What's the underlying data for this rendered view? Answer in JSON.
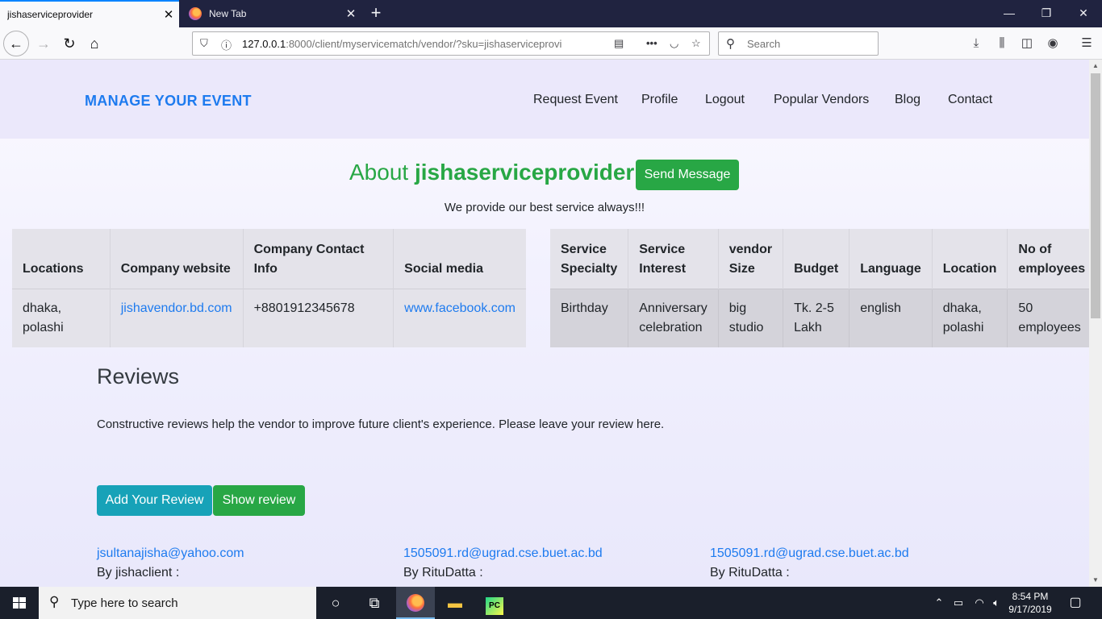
{
  "browser": {
    "tabs": [
      {
        "title": "jishaserviceprovider",
        "active": true
      },
      {
        "title": "New Tab",
        "active": false
      }
    ],
    "url_host": "127.0.0.1",
    "url_rest": ":8000/client/myservicematch/vendor/?sku=jishaserviceprovi",
    "search_placeholder": "Search"
  },
  "site": {
    "brand": "MANAGE YOUR EVENT",
    "nav": [
      "Request Event",
      "Profile",
      "Logout",
      "Popular Vendors",
      "Blog",
      "Contact"
    ]
  },
  "about": {
    "prefix": "About ",
    "vendor_name": "jishaserviceprovider",
    "send_message_label": "Send Message",
    "tagline": "We provide our best service always!!!"
  },
  "company_table": {
    "headers": [
      "Locations",
      "Company website",
      "Company Contact Info",
      "Social media"
    ],
    "row": [
      "dhaka, polashi",
      "jishavendor.bd.com",
      "+8801912345678",
      "www.facebook.com"
    ]
  },
  "service_table": {
    "headers": [
      "Service Specialty",
      "Service Interest",
      "vendor Size",
      "Budget",
      "Language",
      "Location",
      "No of employees"
    ],
    "row": [
      "Birthday",
      "Anniversary celebration",
      "big studio",
      "Tk. 2-5 Lakh",
      "english",
      "dhaka, polashi",
      "50 employees"
    ]
  },
  "reviews": {
    "title": "Reviews",
    "description": "Constructive reviews help the vendor to improve future client's experience. Please leave your review here.",
    "add_label": "Add Your Review",
    "show_label": "Show review",
    "items": [
      {
        "email": "jsultanajisha@yahoo.com",
        "by": "By jishaclient :"
      },
      {
        "email": "1505091.rd@ugrad.cse.buet.ac.bd",
        "by": "By RituDatta :"
      },
      {
        "email": "1505091.rd@ugrad.cse.buet.ac.bd",
        "by": "By RituDatta :"
      }
    ]
  },
  "taskbar": {
    "search_placeholder": "Type here to search",
    "time": "8:54 PM",
    "date": "9/17/2019"
  },
  "colors": {
    "brand_blue": "#1e7bef",
    "success_green": "#28a745",
    "info_cyan": "#17a2b8"
  }
}
